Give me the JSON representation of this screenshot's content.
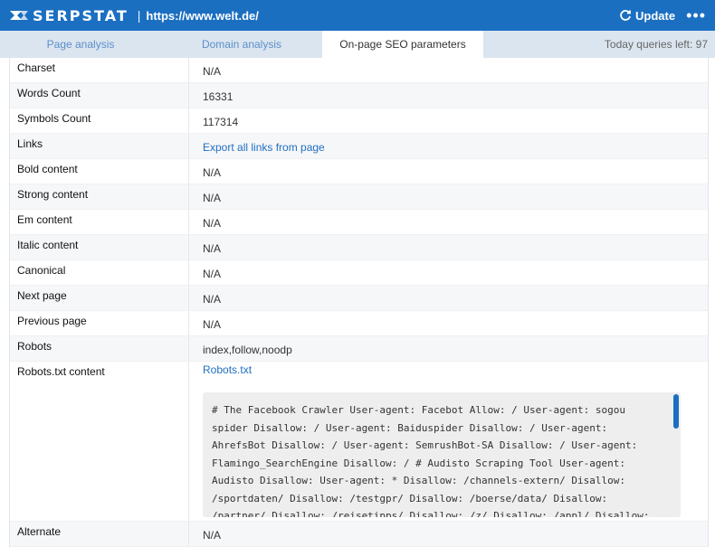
{
  "header": {
    "brand": "SERPSTAT",
    "separator": "|",
    "url": "https://www.welt.de/",
    "update_label": "Update",
    "more_label": "•••",
    "accent": "#1b6fc1"
  },
  "tabs": [
    {
      "label": "Page analysis"
    },
    {
      "label": "Domain analysis"
    },
    {
      "label": "On-page SEO parameters",
      "active": true
    }
  ],
  "queries_left": "Today queries left: 97",
  "rows": [
    {
      "key": "Charset",
      "value": "N/A"
    },
    {
      "key": "Words Count",
      "value": "16331"
    },
    {
      "key": "Symbols Count",
      "value": "117314"
    },
    {
      "key": "Links",
      "value": "Export all links from page"
    },
    {
      "key": "Bold content",
      "value": "N/A"
    },
    {
      "key": "Strong content",
      "value": "N/A"
    },
    {
      "key": "Em content",
      "value": "N/A"
    },
    {
      "key": "Italic content",
      "value": "N/A"
    },
    {
      "key": "Canonical",
      "value": "N/A"
    },
    {
      "key": "Next page",
      "value": "N/A"
    },
    {
      "key": "Previous page",
      "value": "N/A"
    },
    {
      "key": "Robots",
      "value": "index,follow,noodp"
    },
    {
      "key": "Robots.txt content",
      "value": "Robots.txt"
    },
    {
      "key": "Alternate",
      "value": "N/A"
    }
  ],
  "robots_txt_text": "# The Facebook Crawler User-agent: Facebot Allow: / User-agent: sogou spider Disallow: / User-agent: Baiduspider Disallow: / User-agent: AhrefsBot Disallow: / User-agent: SemrushBot-SA Disallow: / User-agent: Flamingo_SearchEngine Disallow: / # Audisto Scraping Tool User-agent: Audisto Disallow: User-agent: * Disallow: /channels-extern/ Disallow: /sportdaten/ Disallow: /testgpr/ Disallow: /boerse/data/ Disallow: /partner/ Disallow: /reisetipps/ Disallow: /z/ Disallow: /appl/ Disallow: /suchen/"
}
